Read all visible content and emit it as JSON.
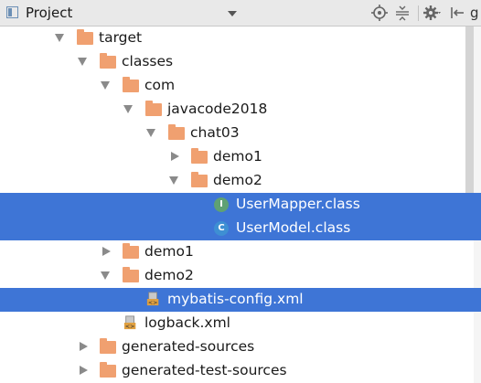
{
  "header": {
    "title": "Project",
    "cut_text": "g"
  },
  "tree": [
    {
      "label": "target",
      "type": "folder",
      "expanded": true
    },
    {
      "label": "classes",
      "type": "folder",
      "expanded": true
    },
    {
      "label": "com",
      "type": "folder",
      "expanded": true
    },
    {
      "label": "javacode2018",
      "type": "folder",
      "expanded": true
    },
    {
      "label": "chat03",
      "type": "folder",
      "expanded": true
    },
    {
      "label": "demo1",
      "type": "folder",
      "expanded": false
    },
    {
      "label": "demo2",
      "type": "folder",
      "expanded": true
    },
    {
      "label": "UserMapper.class",
      "type": "interface-class",
      "icon_letter": "I",
      "selected": true
    },
    {
      "label": "UserModel.class",
      "type": "class",
      "icon_letter": "C",
      "selected": true
    },
    {
      "label": "demo1",
      "type": "folder",
      "expanded": false
    },
    {
      "label": "demo2",
      "type": "folder",
      "expanded": true
    },
    {
      "label": "mybatis-config.xml",
      "type": "xml",
      "selected": true
    },
    {
      "label": "logback.xml",
      "type": "xml"
    },
    {
      "label": "generated-sources",
      "type": "folder",
      "expanded": false
    },
    {
      "label": "generated-test-sources",
      "type": "folder",
      "expanded": false
    }
  ],
  "colors": {
    "selection": "#3e75d6",
    "folder": "#f0a070",
    "interface_icon": "#5fa173",
    "class_icon": "#3e8fd3"
  }
}
